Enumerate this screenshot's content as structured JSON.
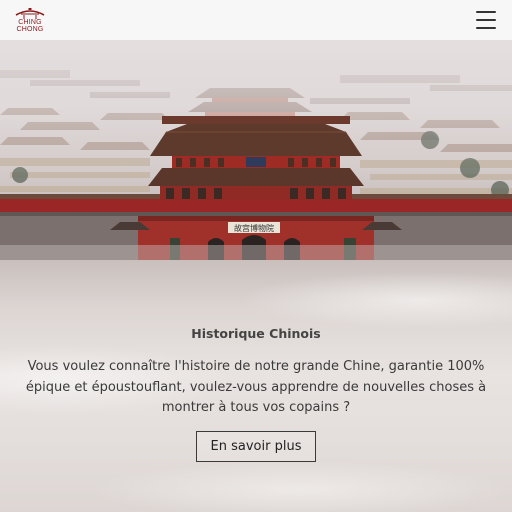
{
  "header": {
    "logo_line1": "CHING",
    "logo_line2": "CHONG",
    "menu_icon": "hamburger-menu-icon"
  },
  "hero": {
    "image": "forbidden-city-aerial-photo",
    "gate_plaque": "故宫博物院"
  },
  "section": {
    "title": "Historique Chinois",
    "text": "Vous voulez connaître l'histoire de notre grande Chine, garantie 100% épique et époustouflant, voulez-vous apprendre de nouvelles choses à montrer à tous vos copains ?",
    "button_label": "En savoir plus"
  },
  "colors": {
    "brand": "#8a1b1b",
    "wall_red": "#9a2626",
    "roof": "#5e3a2c",
    "text": "#3a3a3a"
  }
}
